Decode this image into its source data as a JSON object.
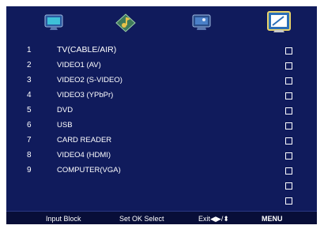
{
  "tabs": [
    {
      "icon": "tv-icon"
    },
    {
      "icon": "music-icon"
    },
    {
      "icon": "picture-icon"
    },
    {
      "icon": "lock-settings-icon",
      "selected": true
    }
  ],
  "rows": [
    {
      "num": "1",
      "label": "TV(CABLE/AIR)"
    },
    {
      "num": "2",
      "label": "VIDEO1 (AV)"
    },
    {
      "num": "3",
      "label": "VIDEO2 (S-VIDEO)"
    },
    {
      "num": "4",
      "label": "VIDEO3 (YPbPr)"
    },
    {
      "num": "5",
      "label": "DVD"
    },
    {
      "num": "6",
      "label": "USB"
    },
    {
      "num": "7",
      "label": "CARD READER"
    },
    {
      "num": "8",
      "label": "VIDEO4 (HDMI)"
    },
    {
      "num": "9",
      "label": "COMPUTER(VGA)"
    },
    {
      "num": "",
      "label": ""
    },
    {
      "num": "",
      "label": ""
    }
  ],
  "footer": {
    "title": "Input Block",
    "select": "Set  OK  Select",
    "exit": "Exit◀▶/⬍",
    "menu": "MENU"
  }
}
